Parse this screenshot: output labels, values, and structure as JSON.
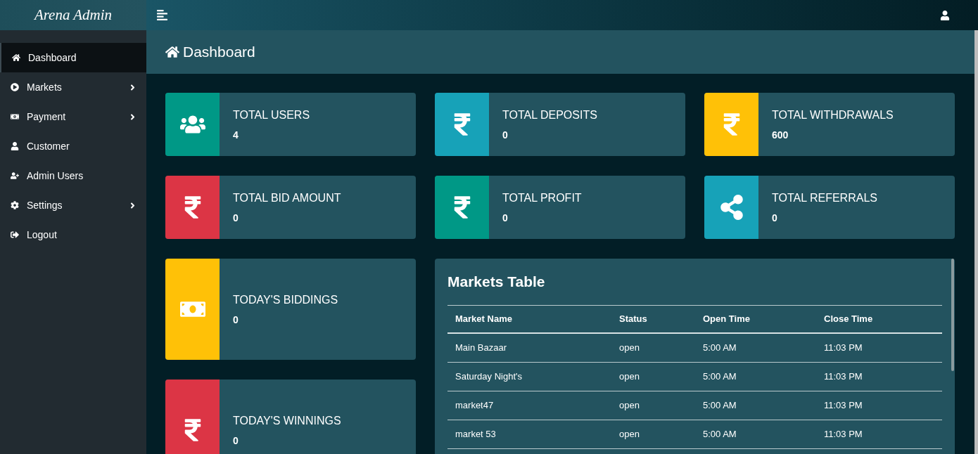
{
  "brand": "Arena Admin",
  "sidebar": {
    "items": [
      {
        "label": "Dashboard",
        "kind": "home",
        "selected": true,
        "expandable": false
      },
      {
        "label": "Markets",
        "kind": "play",
        "selected": false,
        "expandable": true
      },
      {
        "label": "Payment",
        "kind": "money",
        "selected": false,
        "expandable": true
      },
      {
        "label": "Customer",
        "kind": "user",
        "selected": false,
        "expandable": false
      },
      {
        "label": "Admin Users",
        "kind": "user-plus",
        "selected": false,
        "expandable": false
      },
      {
        "label": "Settings",
        "kind": "cog",
        "selected": false,
        "expandable": true
      },
      {
        "label": "Logout",
        "kind": "logout",
        "selected": false,
        "expandable": false
      }
    ]
  },
  "page_title": "Dashboard",
  "stats": [
    {
      "label": "TOTAL USERS",
      "value": "4",
      "kind": "users",
      "color": "#009886"
    },
    {
      "label": "TOTAL DEPOSITS",
      "value": "0",
      "kind": "rupee",
      "color": "#17a2b8"
    },
    {
      "label": "TOTAL WITHDRAWALS",
      "value": "600",
      "kind": "rupee",
      "color": "#ffc107"
    },
    {
      "label": "TOTAL BID AMOUNT",
      "value": "0",
      "kind": "rupee",
      "color": "#dc3545"
    },
    {
      "label": "TOTAL PROFIT",
      "value": "0",
      "kind": "rupee",
      "color": "#009886"
    },
    {
      "label": "TOTAL REFERRALS",
      "value": "0",
      "kind": "share",
      "color": "#17a2b8"
    }
  ],
  "side_stats": [
    {
      "label": "TODAY'S BIDDINGS",
      "value": "0",
      "kind": "money",
      "color": "#ffc107"
    },
    {
      "label": "TODAY'S WINNINGS",
      "value": "0",
      "kind": "rupee",
      "color": "#dc3545"
    }
  ],
  "table": {
    "title": "Markets Table",
    "columns": [
      "Market Name",
      "Status",
      "Open Time",
      "Close Time"
    ],
    "rows": [
      [
        "Main Bazaar",
        "open",
        "5:00 AM",
        "11:03 PM"
      ],
      [
        "Saturday Night's",
        "open",
        "5:00 AM",
        "11:03 PM"
      ],
      [
        "market47",
        "open",
        "5:00 AM",
        "11:03 PM"
      ],
      [
        "market 53",
        "open",
        "5:00 AM",
        "11:03 PM"
      ]
    ]
  }
}
